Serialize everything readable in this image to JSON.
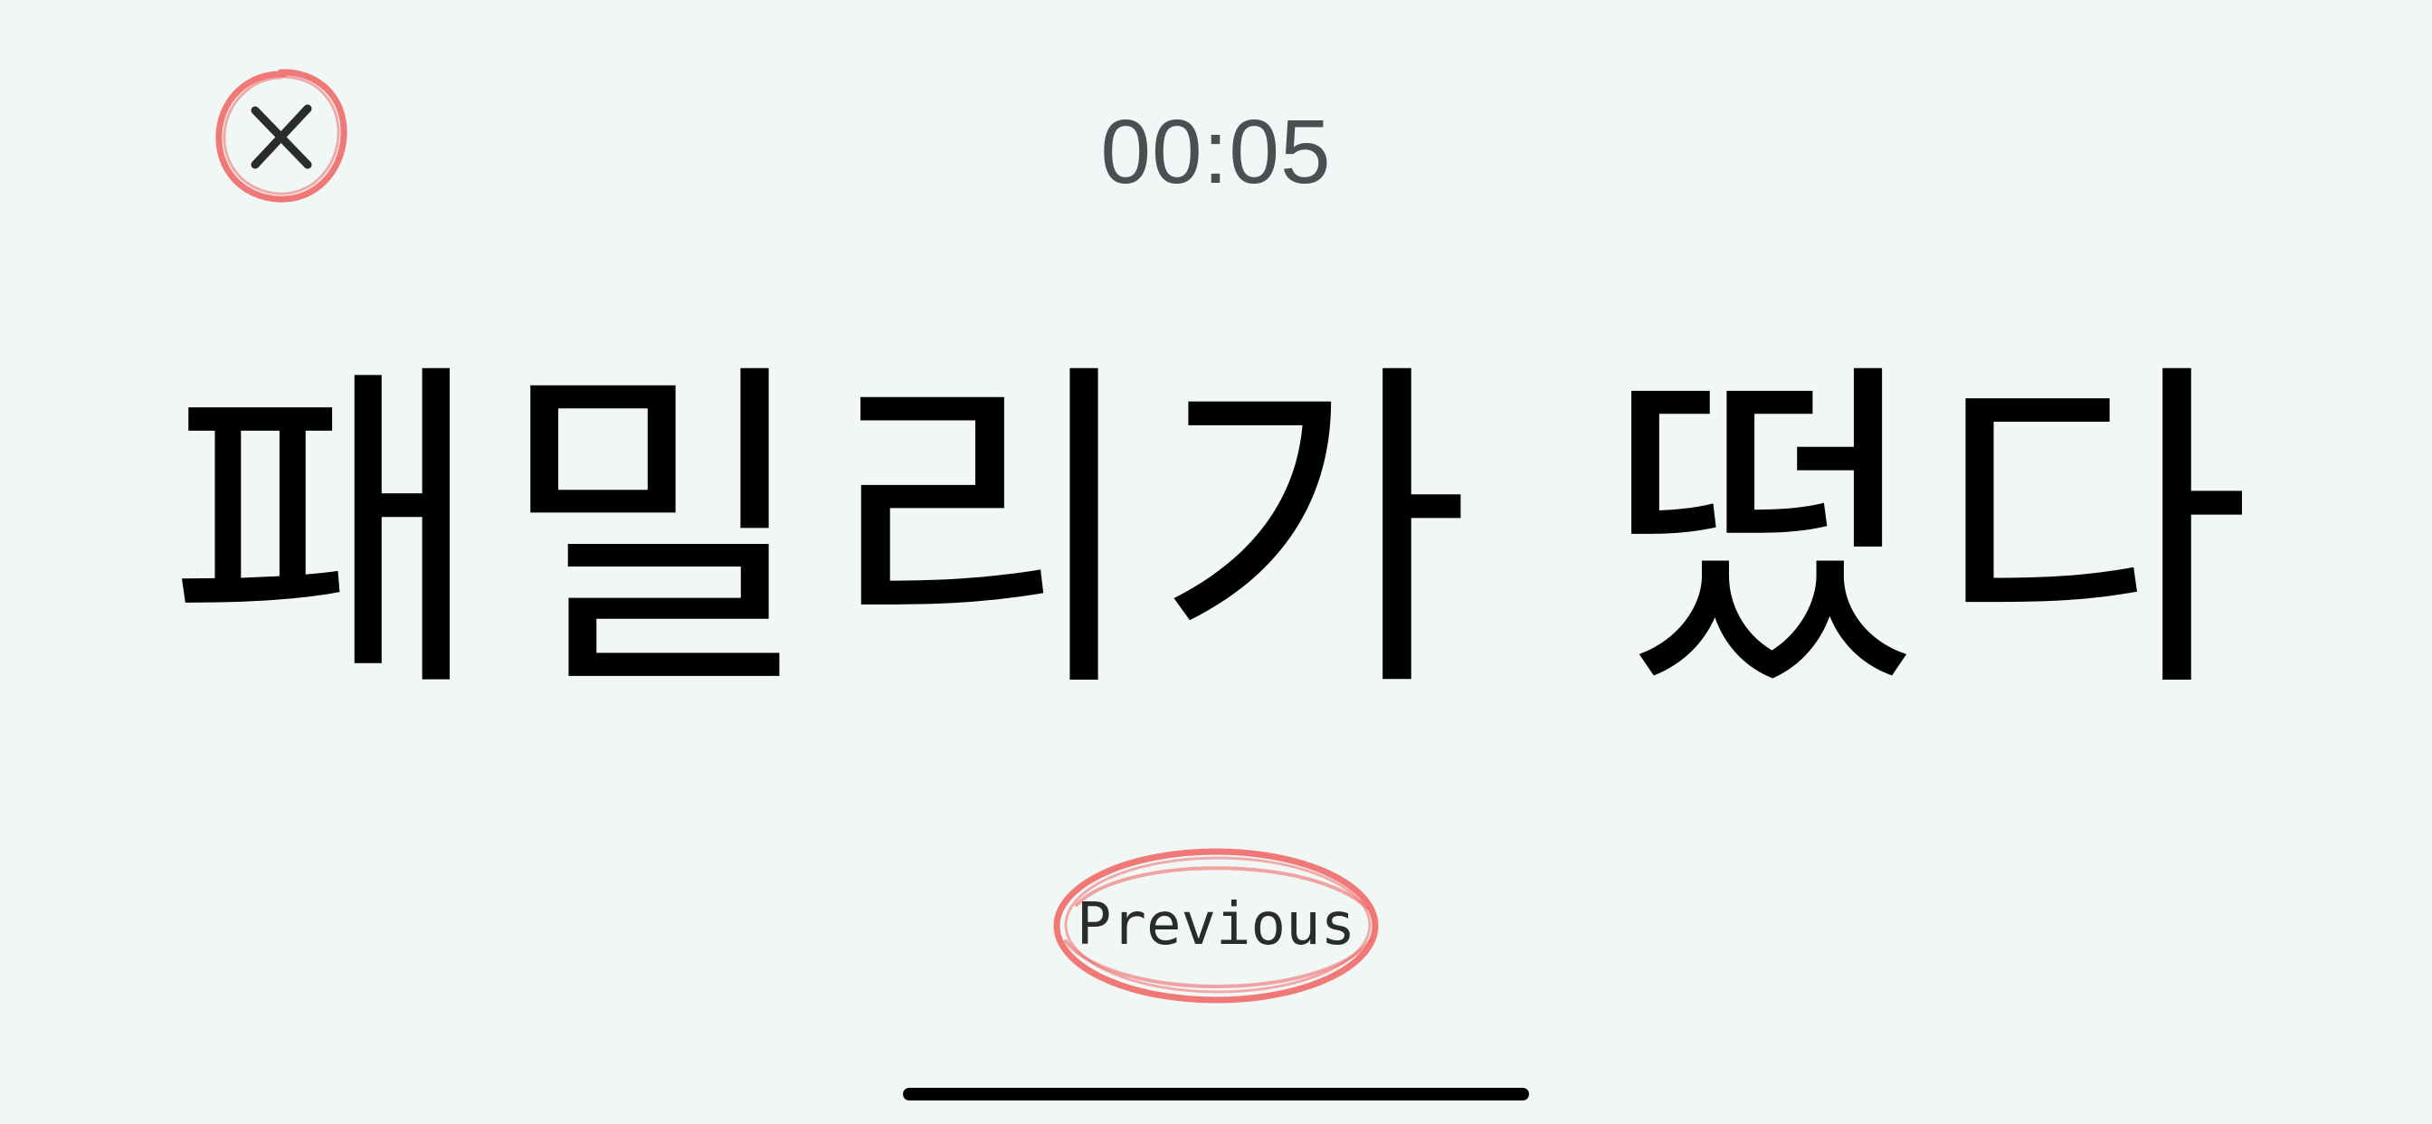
{
  "timer": {
    "text": "00:05"
  },
  "flashcard": {
    "phrase": "패밀리가 떴다"
  },
  "buttons": {
    "close_icon": "close-icon",
    "previous_label": "Previous"
  },
  "colors": {
    "background": "#f1f7f5",
    "accent_scribble": "#f06a6a",
    "text": "#000000",
    "timer_text": "#4a4f54"
  }
}
